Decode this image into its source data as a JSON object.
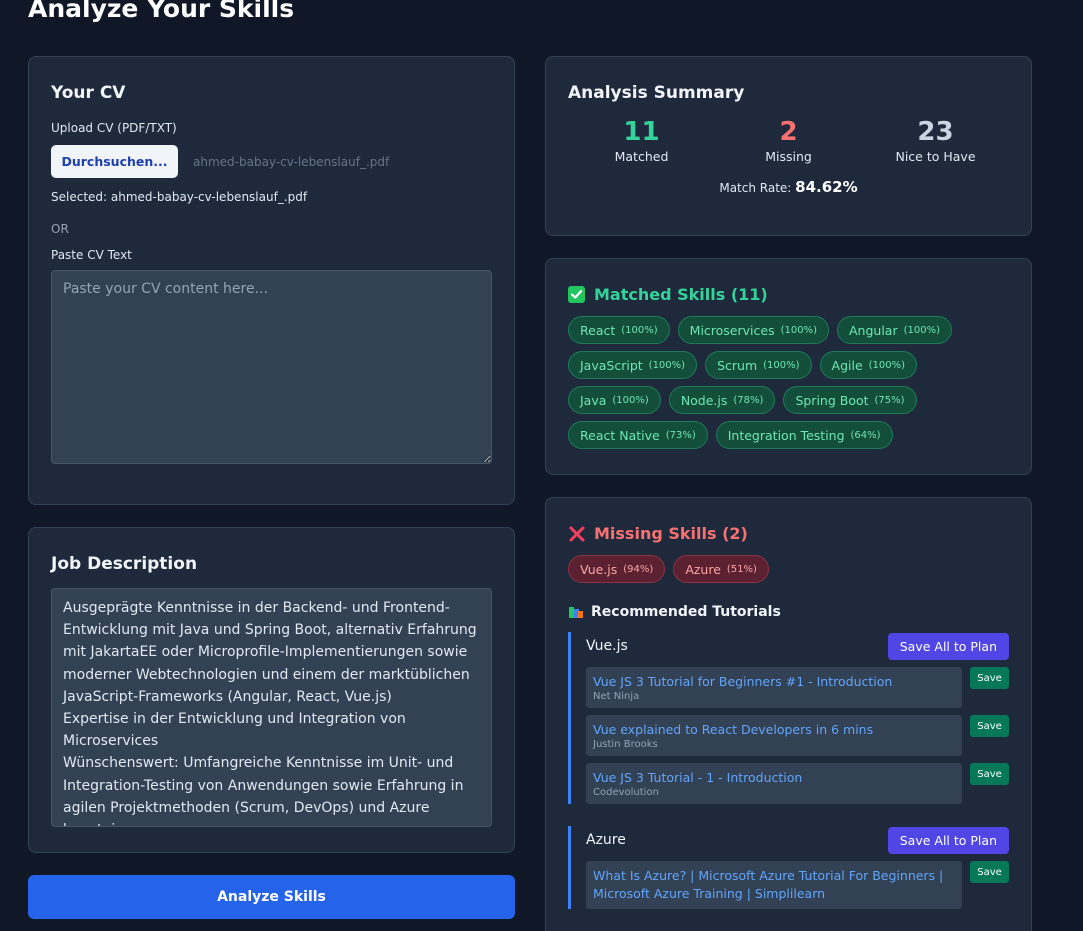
{
  "page": {
    "title": "Analyze Your Skills"
  },
  "cv": {
    "heading": "Your CV",
    "upload_label": "Upload CV (PDF/TXT)",
    "browse_label": "Durchsuchen...",
    "file_name": "ahmed-babay-cv-lebenslauf_.pdf",
    "selected_text": "Selected: ahmed-babay-cv-lebenslauf_.pdf",
    "or_text": "OR",
    "paste_label": "Paste CV Text",
    "paste_placeholder": "Paste your CV content here..."
  },
  "job": {
    "heading": "Job Description",
    "text": "Ausgeprägte Kenntnisse in der Backend- und Frontend-Entwicklung mit Java und Spring Boot, alternativ Erfahrung mit JakartaEE oder Microprofile-Implementierungen sowie moderner Webtechnologien und einem der marktüblichen JavaScript-Frameworks (Angular, React, Vue.js)\nExpertise in der Entwicklung und Integration von Microservices\nWünschenswert: Umfangreiche Kenntnisse im Unit- und Integration-Testing von Anwendungen sowie Erfahrung in agilen Projektmethoden (Scrum, DevOps) und Azure kenntnisse"
  },
  "analyze_button": "Analyze Skills",
  "summary": {
    "heading": "Analysis Summary",
    "matched_count": "11",
    "matched_label": "Matched",
    "missing_count": "2",
    "missing_label": "Missing",
    "nice_count": "23",
    "nice_label": "Nice to Have",
    "rate_label": "Match Rate:",
    "rate_value": "84.62%",
    "colors": {
      "matched": "#34d399",
      "missing": "#f87171",
      "nice": "#cbd5e1"
    }
  },
  "matched": {
    "icon": "check-box-icon",
    "title": "Matched Skills (11)",
    "skills": [
      {
        "name": "React",
        "pct": "(100%)"
      },
      {
        "name": "Microservices",
        "pct": "(100%)"
      },
      {
        "name": "Angular",
        "pct": "(100%)"
      },
      {
        "name": "JavaScript",
        "pct": "(100%)"
      },
      {
        "name": "Scrum",
        "pct": "(100%)"
      },
      {
        "name": "Agile",
        "pct": "(100%)"
      },
      {
        "name": "Java",
        "pct": "(100%)"
      },
      {
        "name": "Node.js",
        "pct": "(78%)"
      },
      {
        "name": "Spring Boot",
        "pct": "(75%)"
      },
      {
        "name": "React Native",
        "pct": "(73%)"
      },
      {
        "name": "Integration Testing",
        "pct": "(64%)"
      }
    ]
  },
  "missing": {
    "icon": "cross-icon",
    "title": "Missing Skills (2)",
    "skills": [
      {
        "name": "Vue.js",
        "pct": "(94%)"
      },
      {
        "name": "Azure",
        "pct": "(51%)"
      }
    ],
    "rec_icon": "books-icon",
    "rec_title": "Recommended Tutorials",
    "groups": [
      {
        "skill": "Vue.js",
        "save_all": "Save All to Plan",
        "tutorials": [
          {
            "title": "Vue JS 3 Tutorial for Beginners #1 - Introduction",
            "author": "Net Ninja",
            "save": "Save"
          },
          {
            "title": "Vue explained to React Developers in 6 mins",
            "author": "Justin Brooks",
            "save": "Save"
          },
          {
            "title": "Vue JS 3 Tutorial - 1 - Introduction",
            "author": "Codevolution",
            "save": "Save"
          }
        ]
      },
      {
        "skill": "Azure",
        "save_all": "Save All to Plan",
        "tutorials": [
          {
            "title": "What Is Azure? | Microsoft Azure Tutorial For Beginners | Microsoft Azure Training | Simplilearn",
            "author": "",
            "save": "Save"
          }
        ]
      }
    ]
  }
}
